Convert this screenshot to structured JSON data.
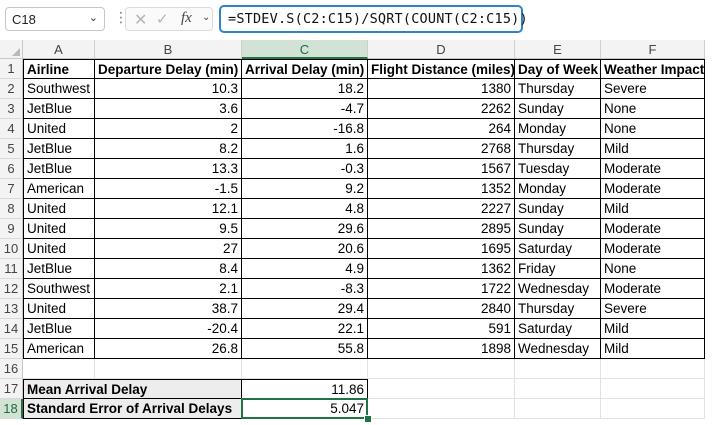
{
  "name_box": {
    "value": "C18"
  },
  "formula_bar": {
    "formula": "=STDEV.S(C2:C15)/SQRT(COUNT(C2:C15))",
    "fx_label": "fx"
  },
  "columns": [
    "A",
    "B",
    "C",
    "D",
    "E",
    "F"
  ],
  "rows": [
    "1",
    "2",
    "3",
    "4",
    "5",
    "6",
    "7",
    "8",
    "9",
    "10",
    "11",
    "12",
    "13",
    "14",
    "15",
    "16",
    "17",
    "18"
  ],
  "headers": [
    "Airline",
    "Departure Delay (min)",
    "Arrival Delay (min)",
    "Flight Distance (miles)",
    "Day of Week",
    "Weather Impact"
  ],
  "records": [
    [
      "Southwest",
      "10.3",
      "18.2",
      "1380",
      "Thursday",
      "Severe"
    ],
    [
      "JetBlue",
      "3.6",
      "-4.7",
      "2262",
      "Sunday",
      "None"
    ],
    [
      "United",
      "2",
      "-16.8",
      "264",
      "Monday",
      "None"
    ],
    [
      "JetBlue",
      "8.2",
      "1.6",
      "2768",
      "Thursday",
      "Mild"
    ],
    [
      "JetBlue",
      "13.3",
      "-0.3",
      "1567",
      "Tuesday",
      "Moderate"
    ],
    [
      "American",
      "-1.5",
      "9.2",
      "1352",
      "Monday",
      "Moderate"
    ],
    [
      "United",
      "12.1",
      "4.8",
      "2227",
      "Sunday",
      "Mild"
    ],
    [
      "United",
      "9.5",
      "29.6",
      "2895",
      "Sunday",
      "Moderate"
    ],
    [
      "United",
      "27",
      "20.6",
      "1695",
      "Saturday",
      "Moderate"
    ],
    [
      "JetBlue",
      "8.4",
      "4.9",
      "1362",
      "Friday",
      "None"
    ],
    [
      "Southwest",
      "2.1",
      "-8.3",
      "1722",
      "Wednesday",
      "Moderate"
    ],
    [
      "United",
      "38.7",
      "29.4",
      "2840",
      "Thursday",
      "Severe"
    ],
    [
      "JetBlue",
      "-20.4",
      "22.1",
      "591",
      "Saturday",
      "Mild"
    ],
    [
      "American",
      "26.8",
      "55.8",
      "1898",
      "Wednesday",
      "Mild"
    ]
  ],
  "summary": [
    {
      "label": "Mean Arrival Delay",
      "value": "11.86"
    },
    {
      "label": "Standard Error of Arrival Delays",
      "value": "5.047"
    }
  ],
  "selection": {
    "column": "C",
    "row": "18"
  },
  "colors": {
    "accent": "#217346",
    "formula_border": "#2e84c6",
    "label_shade": "#ededed"
  }
}
